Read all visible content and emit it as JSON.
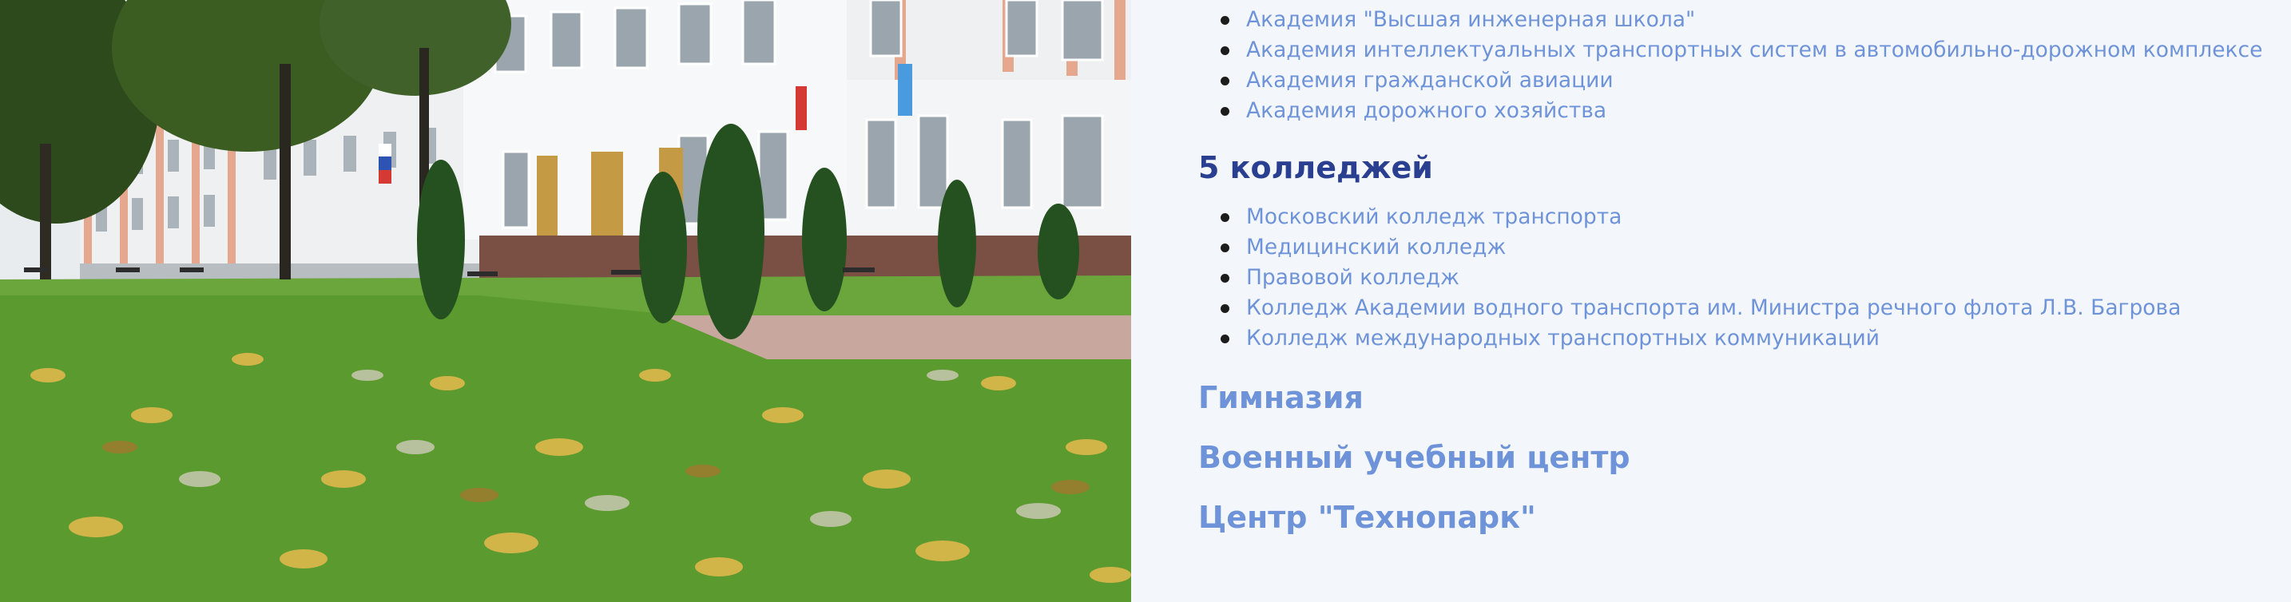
{
  "academies": {
    "items": [
      {
        "label": "Академия \"Высшая инженерная школа\""
      },
      {
        "label": "Академия интеллектуальных транспортных систем в автомобильно-дорожном комплексе"
      },
      {
        "label": "Академия гражданской авиации"
      },
      {
        "label": "Академия дорожного хозяйства"
      }
    ]
  },
  "colleges": {
    "heading": "5 колледжей",
    "items": [
      {
        "label": "Московский колледж транспорта"
      },
      {
        "label": "Медицинский колледж"
      },
      {
        "label": "Правовой колледж"
      },
      {
        "label": "Колледж Академии водного транспорта им. Министра речного флота Л.В. Багрова"
      },
      {
        "label": "Колледж международных транспортных коммуникаций"
      }
    ]
  },
  "sections": {
    "gymnasium": "Гимназия",
    "military_center": "Военный учебный центр",
    "technopark": "Центр \"Технопарк\""
  },
  "colors": {
    "link": "#6f93d8",
    "heading_dark": "#2a3f8f",
    "background": "#f3f7fc"
  }
}
